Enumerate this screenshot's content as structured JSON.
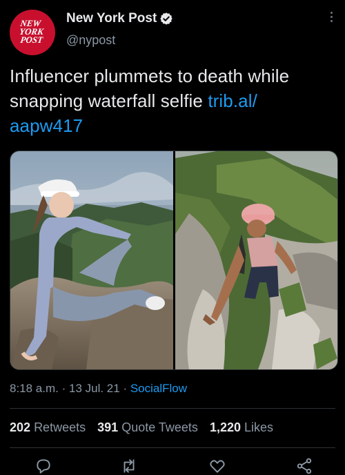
{
  "account": {
    "name": "New York Post",
    "handle": "@nypost",
    "logo_lines": [
      "NEW",
      "YORK",
      "POST"
    ],
    "logo_color": "#c8102e",
    "verified": true
  },
  "tweet": {
    "text": "Influencer plummets to death while snapping waterfall selfie ",
    "link": "trib.al/ aapw417",
    "images": [
      {
        "subject": "woman in visor sitting on rocky summit above green hills and sea"
      },
      {
        "subject": "woman in pink cap climbing a rocky trail"
      }
    ]
  },
  "meta": {
    "time": "8:18 a.m.",
    "sep1": " · ",
    "date": "13 Jul. 21",
    "sep2": " · ",
    "source": "SocialFlow"
  },
  "stats": {
    "retweets_count": "202",
    "retweets_label": "Retweets",
    "quotes_count": "391",
    "quotes_label": "Quote Tweets",
    "likes_count": "1,220",
    "likes_label": "Likes"
  },
  "icons": [
    "more-options-icon",
    "verified-badge-icon",
    "reply-icon",
    "retweet-icon",
    "like-icon",
    "share-icon"
  ],
  "colors": {
    "background": "#000000",
    "link": "#1d9bf0",
    "muted": "#8b98a5",
    "text": "#e7e9ea"
  }
}
